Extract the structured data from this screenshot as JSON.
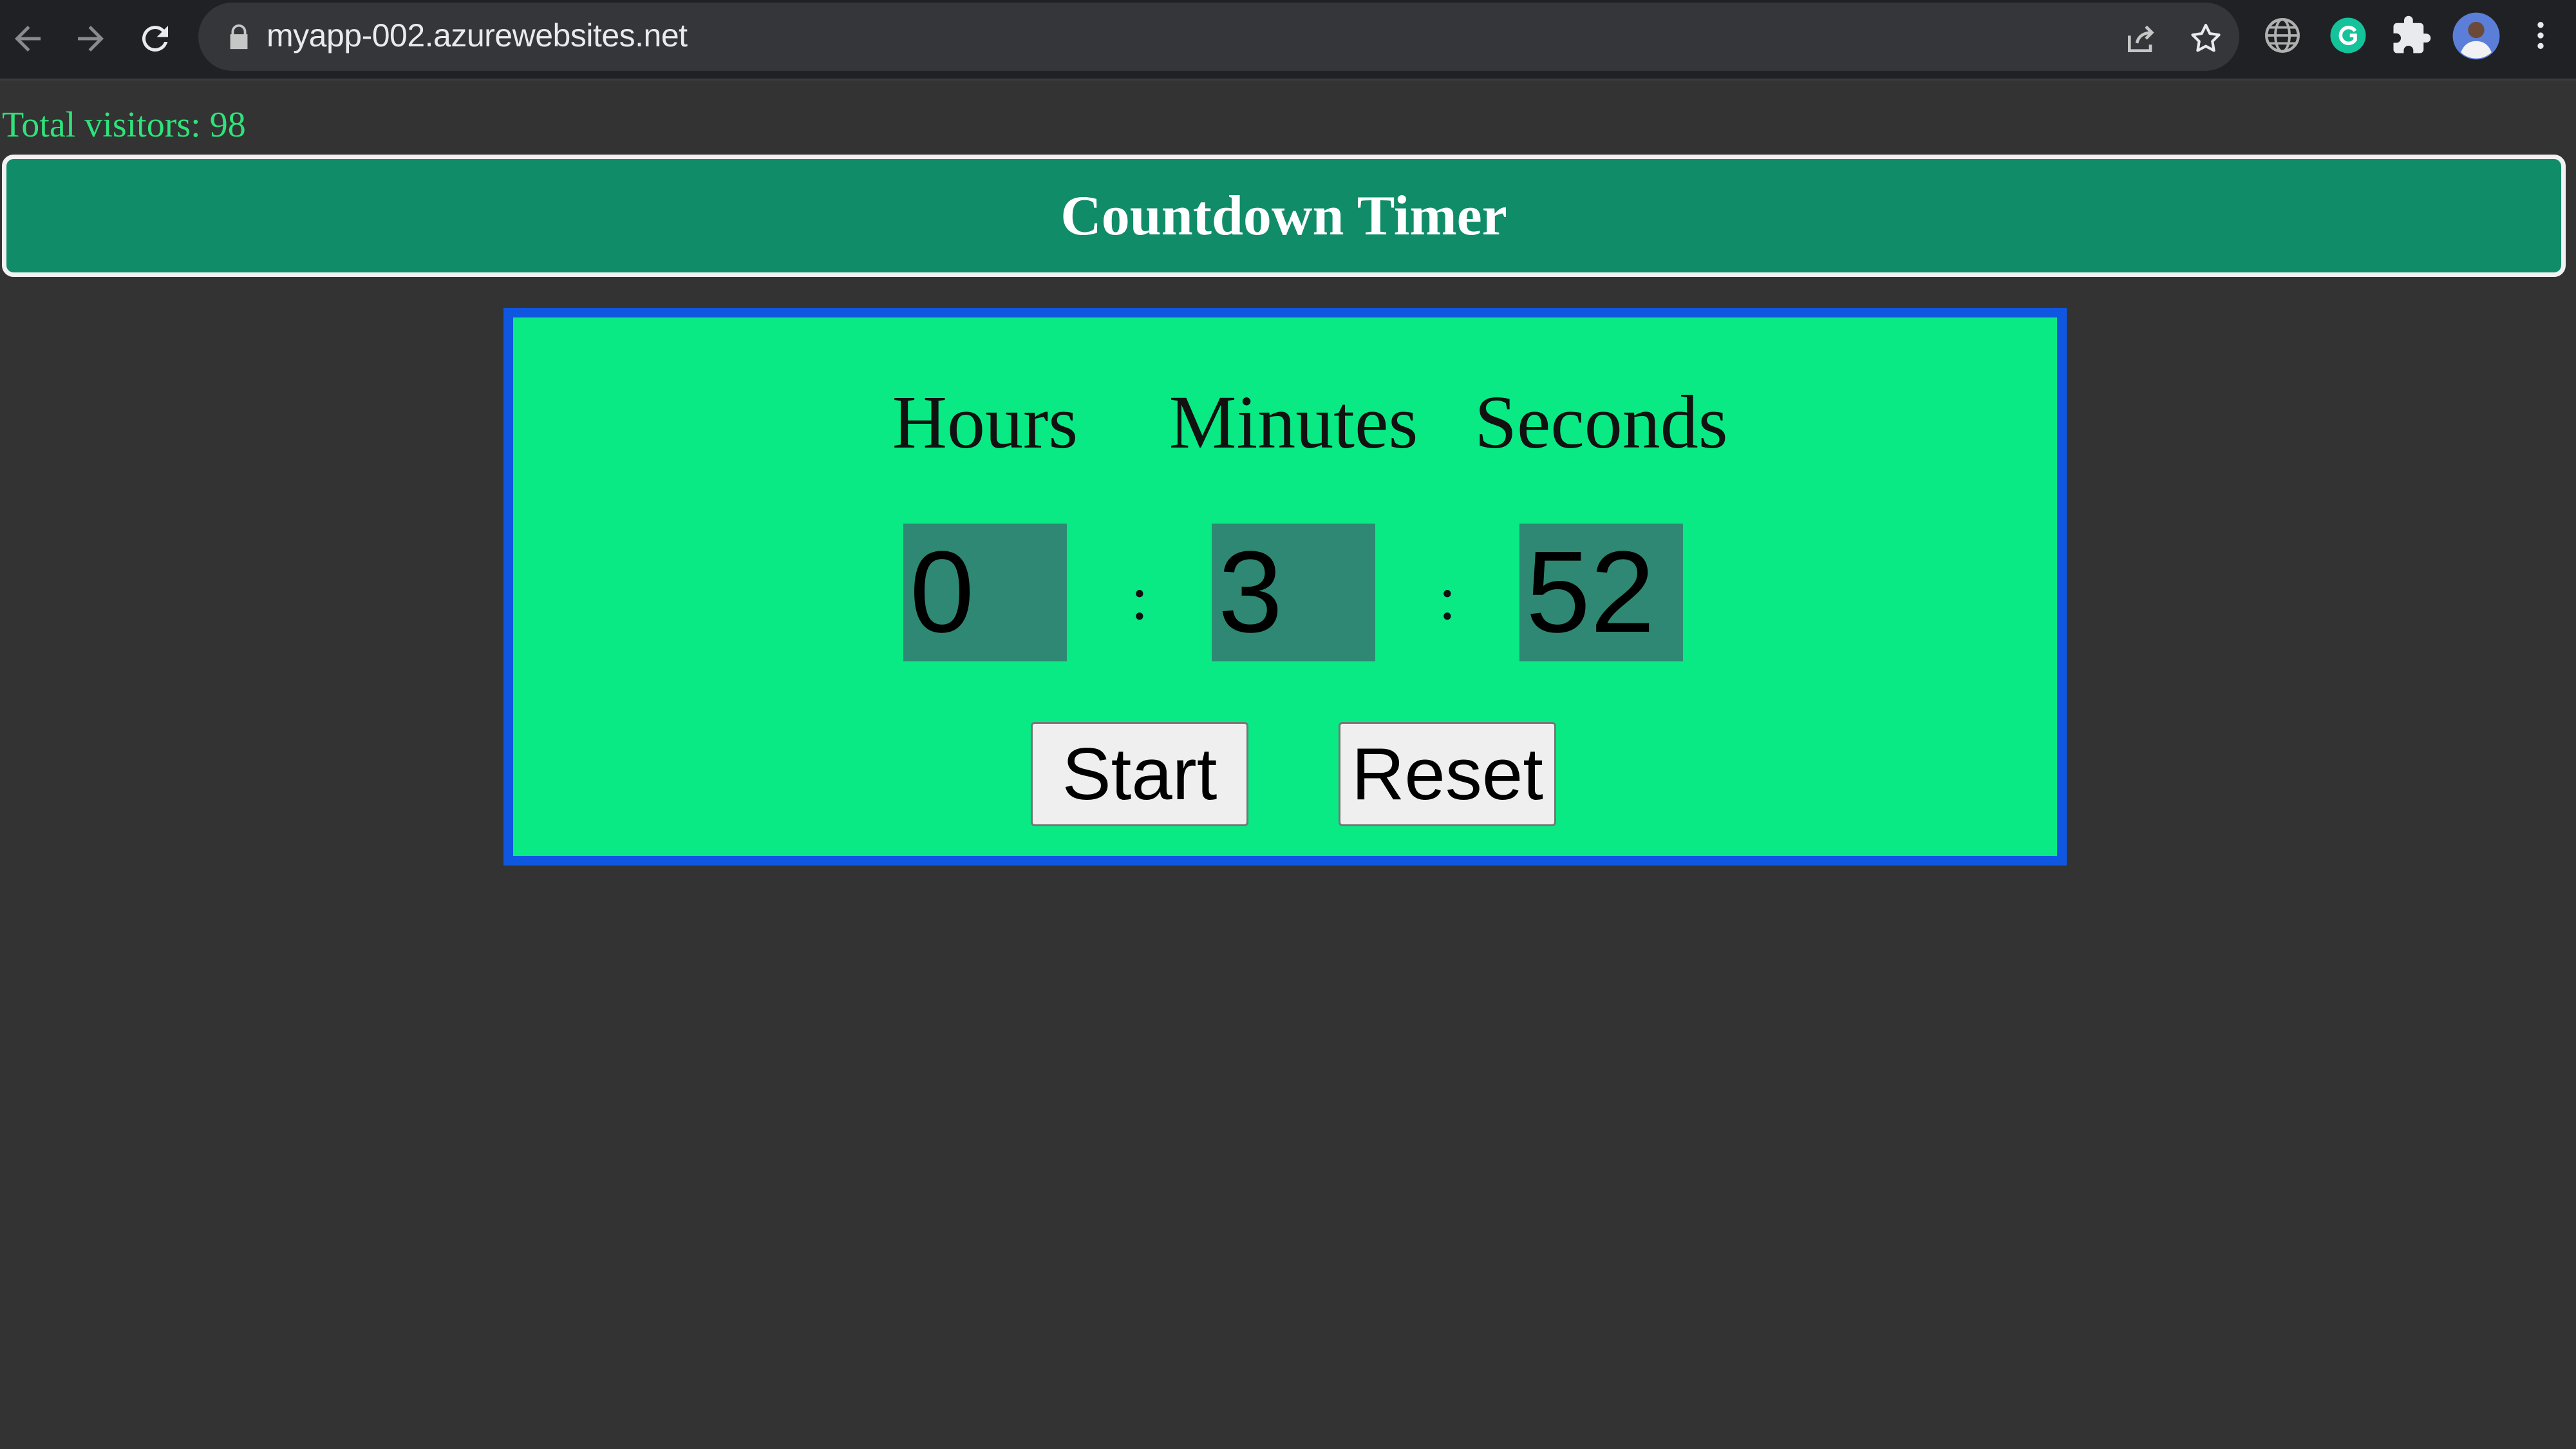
{
  "browser": {
    "url": "myapp-002.azurewebsites.net",
    "icons": [
      "back-icon",
      "forward-icon",
      "reload-icon",
      "lock-icon",
      "share-icon",
      "bookmark-star-icon",
      "globe-extension-icon",
      "grammarly-extension-icon",
      "extensions-puzzle-icon",
      "profile-avatar",
      "kebab-menu-icon"
    ]
  },
  "page": {
    "visitors_text": "Total visitors: 98",
    "title": "Countdown Timer"
  },
  "timer": {
    "labels": {
      "hours": "Hours",
      "minutes": "Minutes",
      "seconds": "Seconds"
    },
    "values": {
      "hours": "0",
      "minutes": "3",
      "seconds": "52"
    },
    "separator": ":",
    "buttons": {
      "start": "Start",
      "reset": "Reset"
    }
  },
  "colors": {
    "background": "#333333",
    "header": "#118c68",
    "panel": "#0aea84",
    "panel_border": "#0f57e0",
    "digit_box": "#2f8873",
    "visitors_text": "#2ee37a"
  }
}
